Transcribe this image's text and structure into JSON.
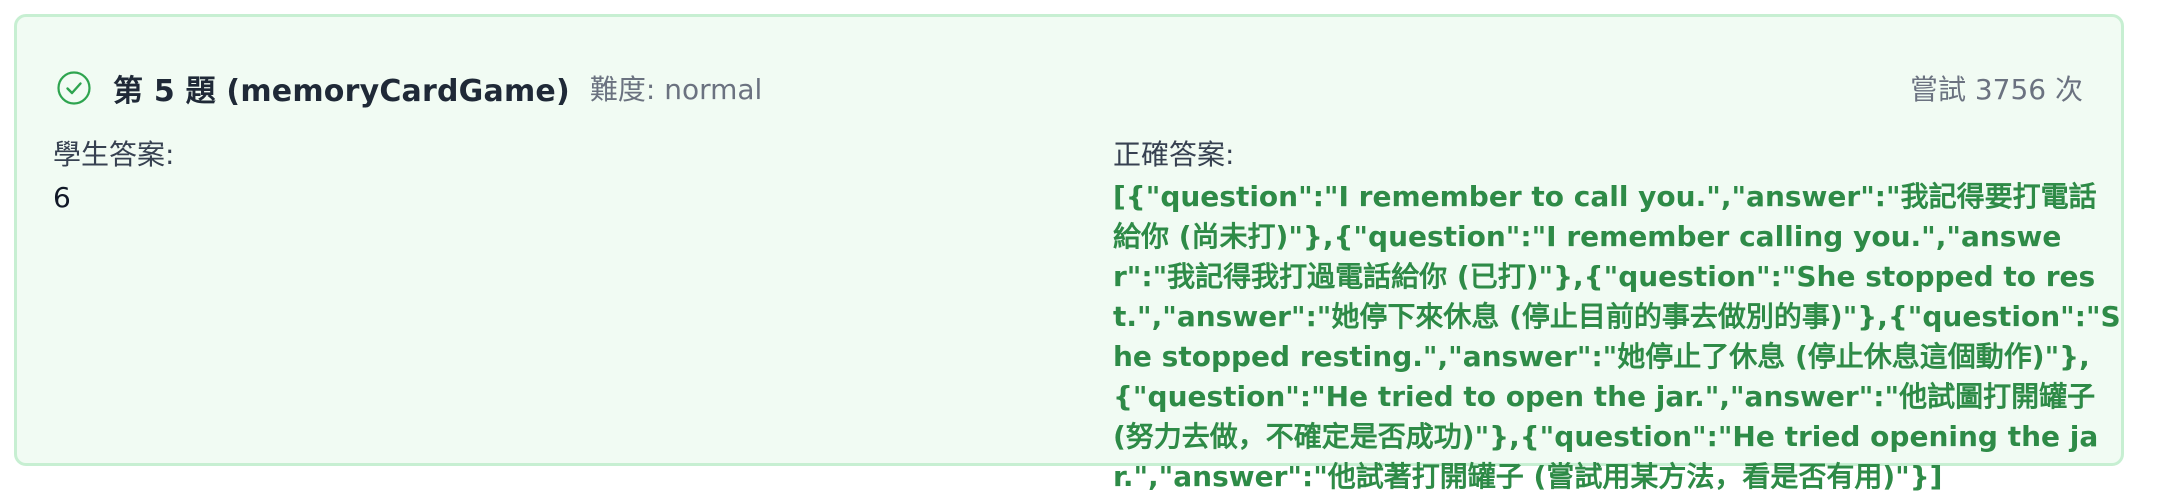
{
  "header": {
    "title": "第 5 題 (memoryCardGame)",
    "difficulty": "難度: normal",
    "attempts": "嘗試 3756 次"
  },
  "student": {
    "label": "學生答案:",
    "answer": "6"
  },
  "correct": {
    "label": "正確答案:",
    "answer": "[{\"question\":\"I remember to call you.\",\"answer\":\"我記得要打電話給你 (尚未打)\"},{\"question\":\"I remember calling you.\",\"answer\":\"我記得我打過電話給你 (已打)\"},{\"question\":\"She stopped to rest.\",\"answer\":\"她停下來休息 (停止目前的事去做別的事)\"},{\"question\":\"She stopped resting.\",\"answer\":\"她停止了休息 (停止休息這個動作)\"},{\"question\":\"He tried to open the jar.\",\"answer\":\"他試圖打開罐子 (努力去做，不確定是否成功)\"},{\"question\":\"He tried opening the jar.\",\"answer\":\"他試著打開罐子 (嘗試用某方法，看是否有用)\"}]"
  },
  "colors": {
    "card_background": "#f1fbf3",
    "card_border": "#c7efd2",
    "correct_text": "#2e8b47",
    "check_icon": "#2ea44f"
  },
  "icons": {
    "status": "check-circle-icon"
  }
}
